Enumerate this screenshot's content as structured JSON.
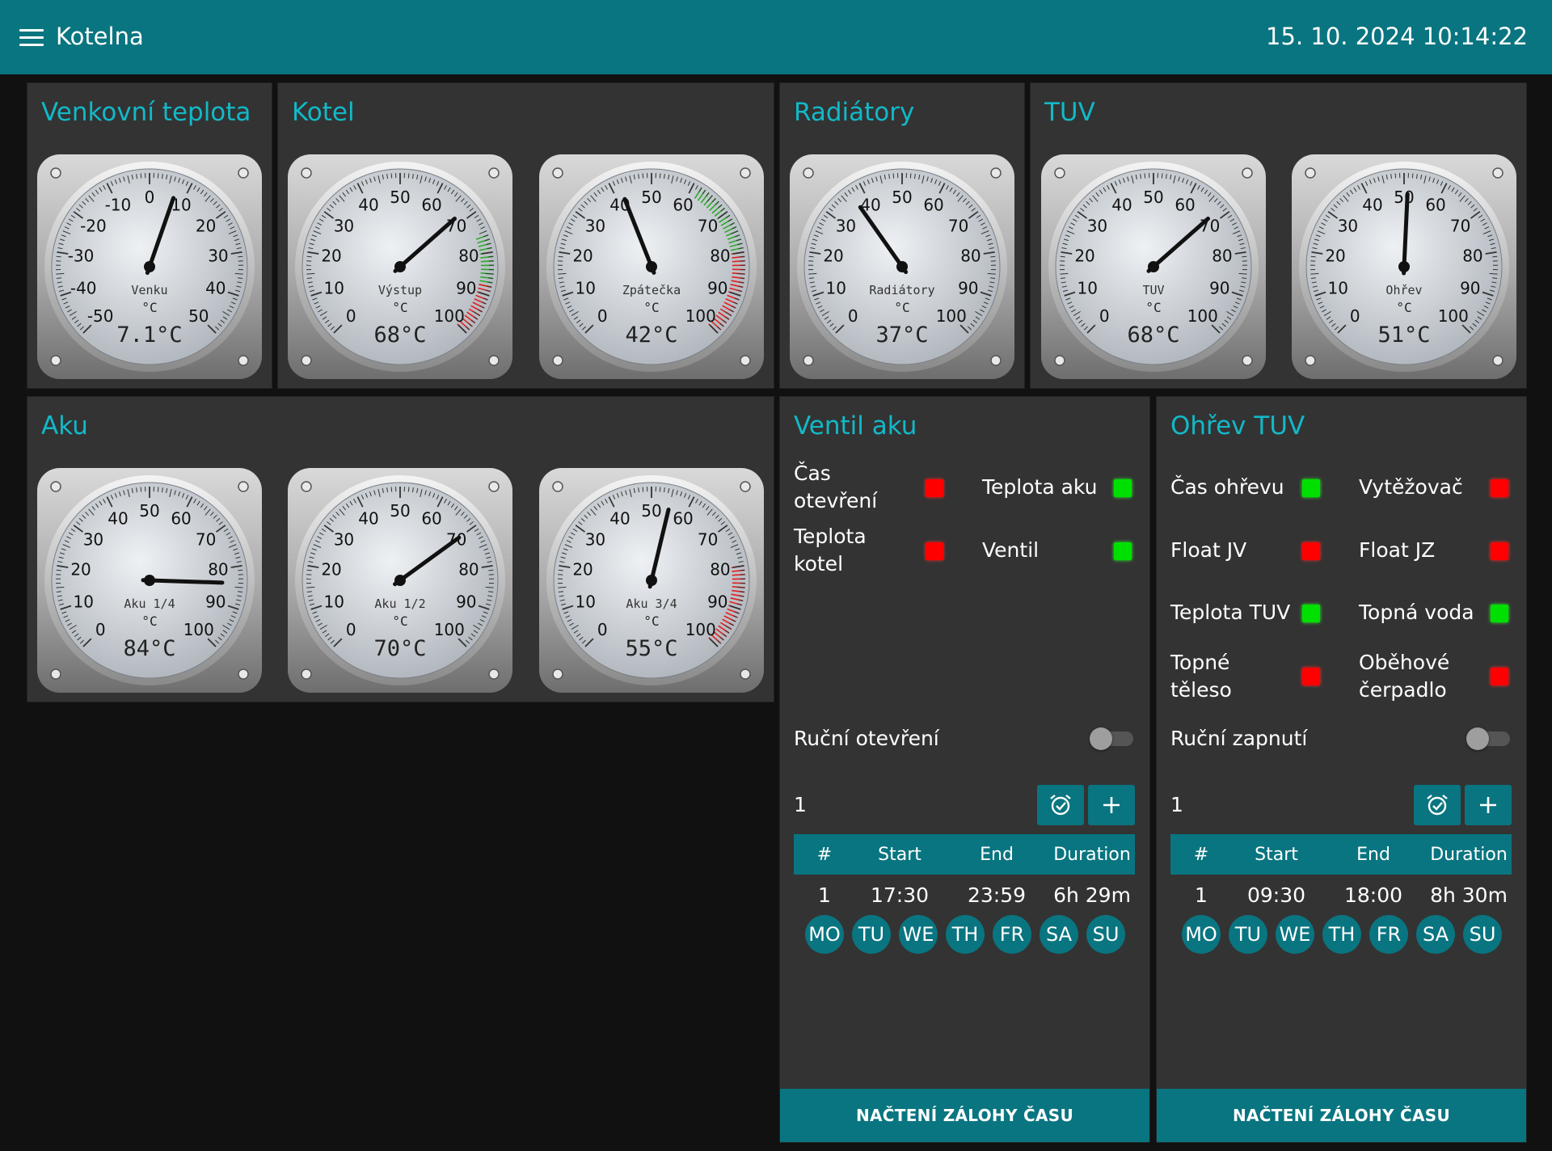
{
  "header": {
    "title": "Kotelna",
    "datetime": "15. 10. 2024 10:14:22"
  },
  "colors": {
    "accent": "#097580",
    "title": "#12b9c8",
    "panel": "#333333",
    "led_on": "#00e000",
    "led_off": "#ff0000"
  },
  "panels": {
    "venkovni": {
      "title": "Venkovní teplota"
    },
    "kotel": {
      "title": "Kotel"
    },
    "radiatory": {
      "title": "Radiátory"
    },
    "tuv": {
      "title": "TUV"
    },
    "aku": {
      "title": "Aku"
    },
    "ventil": {
      "title": "Ventil aku"
    },
    "ohrev": {
      "title": "Ohřev TUV"
    }
  },
  "gauges": [
    {
      "label": "Venku",
      "unit": "°C",
      "value": 7.1,
      "display": "7.1°C",
      "min": -50,
      "max": 50,
      "ticks": [
        -50,
        -40,
        -30,
        -20,
        -10,
        0,
        10,
        20,
        30,
        40,
        50
      ],
      "zones": []
    },
    {
      "label": "Výstup",
      "unit": "°C",
      "value": 68,
      "display": "68°C",
      "min": 0,
      "max": 100,
      "ticks": [
        0,
        10,
        20,
        30,
        40,
        50,
        60,
        70,
        80,
        90,
        100
      ],
      "zones": [
        {
          "from": 76,
          "to": 88,
          "color": "#2ea82e"
        },
        {
          "from": 88,
          "to": 100,
          "color": "#e02020"
        }
      ]
    },
    {
      "label": "Zpátečka",
      "unit": "°C",
      "value": 42,
      "display": "42°C",
      "min": 0,
      "max": 100,
      "ticks": [
        0,
        10,
        20,
        30,
        40,
        50,
        60,
        70,
        80,
        90,
        100
      ],
      "zones": [
        {
          "from": 62,
          "to": 80,
          "color": "#2ea82e"
        },
        {
          "from": 80,
          "to": 100,
          "color": "#e02020"
        }
      ]
    },
    {
      "label": "Radiátory",
      "unit": "°C",
      "value": 37,
      "display": "37°C",
      "min": 0,
      "max": 100,
      "ticks": [
        0,
        10,
        20,
        30,
        40,
        50,
        60,
        70,
        80,
        90,
        100
      ],
      "zones": []
    },
    {
      "label": "TUV",
      "unit": "°C",
      "value": 68,
      "display": "68°C",
      "min": 0,
      "max": 100,
      "ticks": [
        0,
        10,
        20,
        30,
        40,
        50,
        60,
        70,
        80,
        90,
        100
      ],
      "zones": []
    },
    {
      "label": "Ohřev",
      "unit": "°C",
      "value": 51,
      "display": "51°C",
      "min": 0,
      "max": 100,
      "ticks": [
        0,
        10,
        20,
        30,
        40,
        50,
        60,
        70,
        80,
        90,
        100
      ],
      "zones": []
    },
    {
      "label": "Aku 1/4",
      "unit": "°C",
      "value": 84,
      "display": "84°C",
      "min": 0,
      "max": 100,
      "ticks": [
        0,
        10,
        20,
        30,
        40,
        50,
        60,
        70,
        80,
        90,
        100
      ],
      "zones": []
    },
    {
      "label": "Aku 1/2",
      "unit": "°C",
      "value": 70,
      "display": "70°C",
      "min": 0,
      "max": 100,
      "ticks": [
        0,
        10,
        20,
        30,
        40,
        50,
        60,
        70,
        80,
        90,
        100
      ],
      "zones": []
    },
    {
      "label": "Aku 3/4",
      "unit": "°C",
      "value": 55,
      "display": "55°C",
      "min": 0,
      "max": 100,
      "ticks": [
        0,
        10,
        20,
        30,
        40,
        50,
        60,
        70,
        80,
        90,
        100
      ],
      "zones": [
        {
          "from": 80,
          "to": 100,
          "color": "#e02020"
        }
      ]
    }
  ],
  "ventil": {
    "indicators": [
      {
        "label": "Čas otevření",
        "state": "red"
      },
      {
        "label": "Teplota aku",
        "state": "green"
      },
      {
        "label": "Teplota kotel",
        "state": "red"
      },
      {
        "label": "Ventil",
        "state": "green"
      }
    ],
    "manual_label": "Ruční otevření",
    "count": "1",
    "table": {
      "headers": [
        "#",
        "Start",
        "End",
        "Duration"
      ],
      "rows": [
        {
          "n": "1",
          "start": "17:30",
          "end": "23:59",
          "duration": "6h 29m"
        }
      ]
    },
    "days": [
      "MO",
      "TU",
      "WE",
      "TH",
      "FR",
      "SA",
      "SU"
    ],
    "button": "NAČTENÍ ZÁLOHY ČASU"
  },
  "ohrev": {
    "indicators": [
      {
        "label": "Čas ohřevu",
        "state": "green"
      },
      {
        "label": "Vytěžovač",
        "state": "red"
      },
      {
        "label": "Float JV",
        "state": "red"
      },
      {
        "label": "Float JZ",
        "state": "red"
      },
      {
        "label": "Teplota TUV",
        "state": "green"
      },
      {
        "label": "Topná voda",
        "state": "green"
      },
      {
        "label": "Topné těleso",
        "state": "red"
      },
      {
        "label": "Oběhové čerpadlo",
        "state": "red"
      }
    ],
    "manual_label": "Ruční zapnutí",
    "count": "1",
    "table": {
      "headers": [
        "#",
        "Start",
        "End",
        "Duration"
      ],
      "rows": [
        {
          "n": "1",
          "start": "09:30",
          "end": "18:00",
          "duration": "8h 30m"
        }
      ]
    },
    "days": [
      "MO",
      "TU",
      "WE",
      "TH",
      "FR",
      "SA",
      "SU"
    ],
    "button": "NAČTENÍ ZÁLOHY ČASU"
  }
}
